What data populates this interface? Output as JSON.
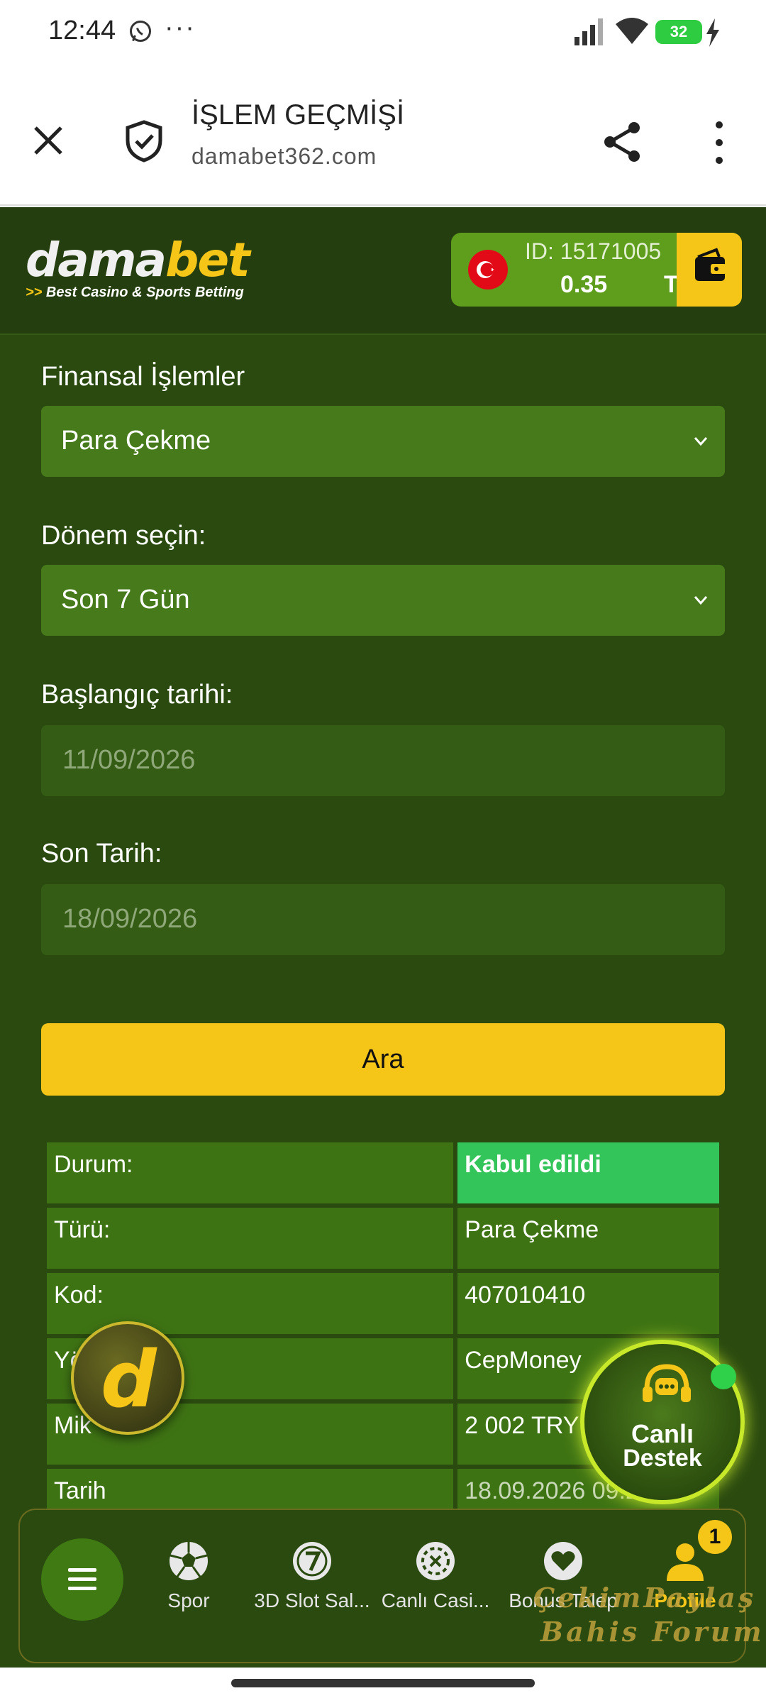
{
  "status_bar": {
    "time": "12:44",
    "more": "···",
    "battery": "32"
  },
  "browser": {
    "title": "İŞLEM GEÇMİŞİ",
    "url": "damabet362.com"
  },
  "site": {
    "logo_part1": "dama",
    "logo_part2": "bet",
    "tagline_arrows": ">>",
    "tagline": "Best Casino & Sports Betting",
    "account_id": "ID: 15171005",
    "balance": "0.35",
    "currency": "TRY"
  },
  "form": {
    "financial_label": "Finansal İşlemler",
    "financial_value": "Para Çekme",
    "period_label": "Dönem seçin:",
    "period_value": "Son 7 Gün",
    "start_label": "Başlangıç tarihi:",
    "start_value": "11/09/2026",
    "end_label": "Son Tarih:",
    "end_value": "18/09/2026",
    "search_button": "Ara"
  },
  "results": [
    {
      "key": "Durum:",
      "value": "Kabul edildi"
    },
    {
      "key": "Türü:",
      "value": "Para Çekme"
    },
    {
      "key": "Kod:",
      "value": "407010410"
    },
    {
      "key": "Yö",
      "value": "CepMoney"
    },
    {
      "key": "Mik",
      "value": "2 002 TRY"
    },
    {
      "key": "Tarih",
      "value": "18.09.2026 09:2"
    }
  ],
  "floating": {
    "d_letter": "d",
    "support_line1": "Canlı",
    "support_line2": "Destek"
  },
  "bottom_nav": {
    "items": [
      "Spor",
      "3D Slot Sal...",
      "Canlı Casi...",
      "Bonus Talep",
      "Profile"
    ],
    "badge": "1",
    "active_index": 4
  },
  "watermark": {
    "line1": "ÇekimPaylaş",
    "line2": "Bahis Forum"
  },
  "colors": {
    "brand_yellow": "#f5c518",
    "bg_green": "#2a4a10",
    "success": "#33c45a"
  }
}
